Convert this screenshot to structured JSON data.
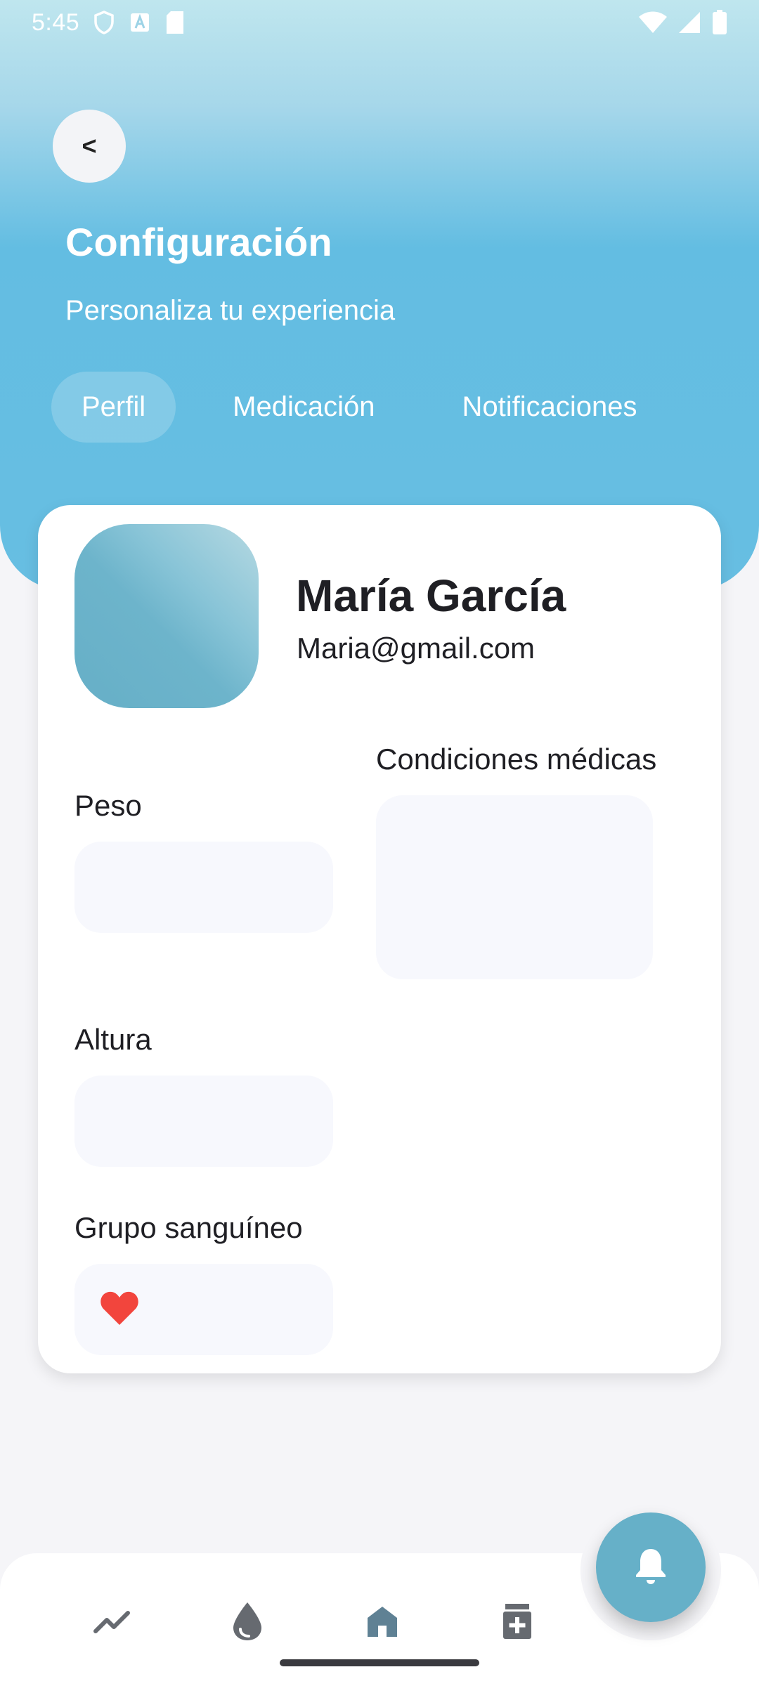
{
  "status_bar": {
    "time": "5:45",
    "left_icons": [
      "shield-icon",
      "a-notification-icon",
      "sd-card-icon"
    ],
    "right_icons": [
      "wifi-icon",
      "cell-signal-icon",
      "battery-icon"
    ]
  },
  "header": {
    "back_label": "<",
    "title": "Configuración",
    "subtitle": "Personaliza tu experiencia",
    "gradient_colors": [
      "#bfe6ee",
      "#63bde2"
    ]
  },
  "tabs": [
    {
      "label": "Perfil",
      "active": true
    },
    {
      "label": "Medicación",
      "active": false
    },
    {
      "label": "Notificaciones",
      "active": false
    }
  ],
  "profile": {
    "name": "María García",
    "email": "Maria@gmail.com"
  },
  "fields": {
    "peso": {
      "label": "Peso",
      "value": ""
    },
    "condiciones": {
      "label": "Condiciones médicas",
      "value": ""
    },
    "altura": {
      "label": "Altura",
      "value": ""
    },
    "grupo_sanguineo": {
      "label": "Grupo sanguíneo",
      "value": "",
      "icon": "heart-icon"
    }
  },
  "bottom_nav": {
    "items": [
      "trend-chart-icon",
      "water-drop-icon",
      "home-icon",
      "medication-icon"
    ],
    "active": "home-icon",
    "fab_icon": "bell-icon"
  },
  "colors": {
    "accent": "#66b0c8",
    "heart": "#f2453d",
    "nav_active": "#5f8194",
    "nav_inactive": "#666a70"
  }
}
